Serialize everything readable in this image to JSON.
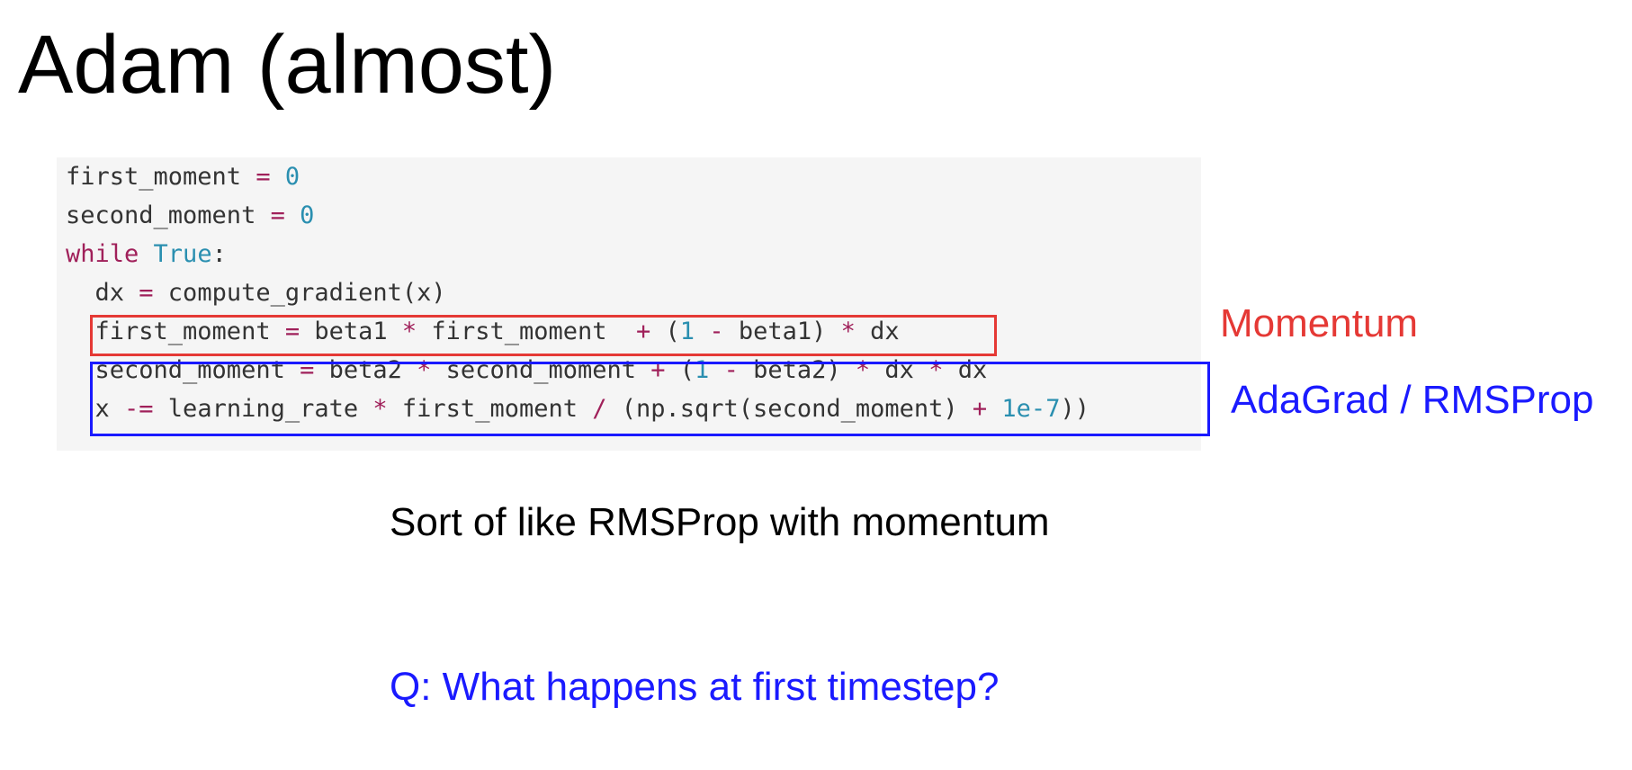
{
  "slide": {
    "title": "Adam (almost)",
    "subtitle": "Sort of like RMSProp with momentum",
    "question": "Q: What happens at first timestep?"
  },
  "annotations": {
    "momentum_label": "Momentum",
    "adagrad_label": "AdaGrad / RMSProp"
  },
  "code": {
    "lines": [
      [
        {
          "t": "first_moment ",
          "c": "plain"
        },
        {
          "t": "=",
          "c": "op"
        },
        {
          "t": " ",
          "c": "plain"
        },
        {
          "t": "0",
          "c": "num"
        }
      ],
      [
        {
          "t": "second_moment ",
          "c": "plain"
        },
        {
          "t": "=",
          "c": "op"
        },
        {
          "t": " ",
          "c": "plain"
        },
        {
          "t": "0",
          "c": "num"
        }
      ],
      [
        {
          "t": "while",
          "c": "kw"
        },
        {
          "t": " ",
          "c": "plain"
        },
        {
          "t": "True",
          "c": "bool"
        },
        {
          "t": ":",
          "c": "plain"
        }
      ],
      [
        {
          "t": "  dx ",
          "c": "plain"
        },
        {
          "t": "=",
          "c": "op"
        },
        {
          "t": " compute_gradient(x)",
          "c": "plain"
        }
      ],
      [
        {
          "t": "  first_moment ",
          "c": "plain"
        },
        {
          "t": "=",
          "c": "op"
        },
        {
          "t": " beta1 ",
          "c": "plain"
        },
        {
          "t": "*",
          "c": "op"
        },
        {
          "t": " first_moment  ",
          "c": "plain"
        },
        {
          "t": "+",
          "c": "op"
        },
        {
          "t": " (",
          "c": "plain"
        },
        {
          "t": "1",
          "c": "num"
        },
        {
          "t": " ",
          "c": "plain"
        },
        {
          "t": "-",
          "c": "op"
        },
        {
          "t": " beta1) ",
          "c": "plain"
        },
        {
          "t": "*",
          "c": "op"
        },
        {
          "t": " dx",
          "c": "plain"
        }
      ],
      [
        {
          "t": "  second_moment ",
          "c": "plain"
        },
        {
          "t": "=",
          "c": "op"
        },
        {
          "t": " beta2 ",
          "c": "plain"
        },
        {
          "t": "*",
          "c": "op"
        },
        {
          "t": " second_moment ",
          "c": "plain"
        },
        {
          "t": "+",
          "c": "op"
        },
        {
          "t": " (",
          "c": "plain"
        },
        {
          "t": "1",
          "c": "num"
        },
        {
          "t": " ",
          "c": "plain"
        },
        {
          "t": "-",
          "c": "op"
        },
        {
          "t": " beta2) ",
          "c": "plain"
        },
        {
          "t": "*",
          "c": "op"
        },
        {
          "t": " dx ",
          "c": "plain"
        },
        {
          "t": "*",
          "c": "op"
        },
        {
          "t": " dx",
          "c": "plain"
        }
      ],
      [
        {
          "t": "  x ",
          "c": "plain"
        },
        {
          "t": "-=",
          "c": "op"
        },
        {
          "t": " learning_rate ",
          "c": "plain"
        },
        {
          "t": "*",
          "c": "op"
        },
        {
          "t": " first_moment ",
          "c": "plain"
        },
        {
          "t": "/",
          "c": "op"
        },
        {
          "t": " (np.sqrt(second_moment) ",
          "c": "plain"
        },
        {
          "t": "+",
          "c": "op"
        },
        {
          "t": " ",
          "c": "plain"
        },
        {
          "t": "1e-7",
          "c": "num"
        },
        {
          "t": "))",
          "c": "plain"
        }
      ]
    ]
  },
  "colors": {
    "momentum": "#e53935",
    "adagrad": "#1a1aff",
    "keyword": "#a0205a",
    "number": "#2a8fb0",
    "code_background": "#f5f5f5"
  }
}
